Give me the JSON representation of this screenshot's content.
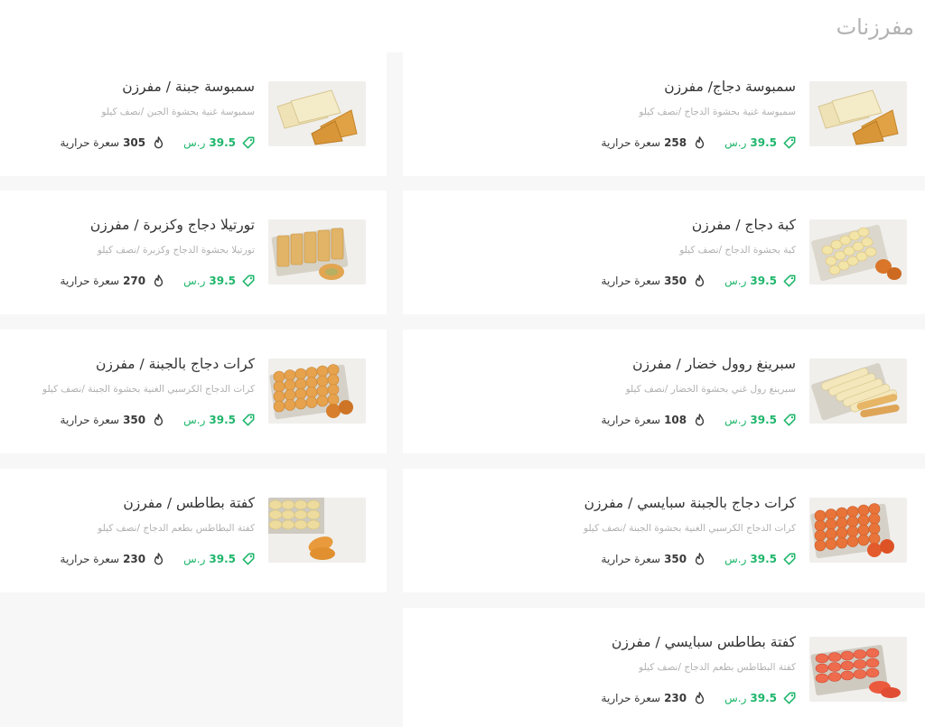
{
  "section": {
    "title": "مفرزنات"
  },
  "colors": {
    "price": "#1fb66b",
    "title": "#333333",
    "desc": "#b0b0b0",
    "background": "#f7f7f7"
  },
  "items": [
    {
      "title": "سمبوسة دجاج/ مفرزن",
      "desc": "سمبوسة غنية بحشوة الدجاج /نصف كيلو",
      "price": "39.5",
      "currency": "ر.س",
      "calories": "258",
      "calories_label": "سعرة حرارية",
      "image": "samosa-icon"
    },
    {
      "title": "سمبوسة جبنة / مفرزن",
      "desc": "سمبوسة غنية بحشوة الجبن /نصف كيلو",
      "price": "39.5",
      "currency": "ر.س",
      "calories": "305",
      "calories_label": "سعرة حرارية",
      "image": "samosa-icon"
    },
    {
      "title": "كبة دجاج / مفرزن",
      "desc": "كبة بحشوة الدجاج /نصف كيلو",
      "price": "39.5",
      "currency": "ر.س",
      "calories": "350",
      "calories_label": "سعرة حرارية",
      "image": "kibbeh-icon"
    },
    {
      "title": "تورتيلا دجاج وكزبرة / مفرزن",
      "desc": "تورتيلا بحشوة الدجاج وكزبرة /نصف كيلو",
      "price": "39.5",
      "currency": "ر.س",
      "calories": "270",
      "calories_label": "سعرة حرارية",
      "image": "tortilla-icon"
    },
    {
      "title": "سبرينغ روول خضار / مفرزن",
      "desc": "سبرينغ رول غني بحشوة الخضار /نصف كيلو",
      "price": "39.5",
      "currency": "ر.س",
      "calories": "108",
      "calories_label": "سعرة حرارية",
      "image": "spring-roll-icon"
    },
    {
      "title": "كرات دجاج بالجبنة / مفرزن",
      "desc": "كرات الدجاج الكرسبي الغنية بحشوة الجبنة /نصف كيلو",
      "price": "39.5",
      "currency": "ر.س",
      "calories": "350",
      "calories_label": "سعرة حرارية",
      "image": "chicken-balls-icon"
    },
    {
      "title": "كرات دجاج بالجبنة سبايسي / مفرزن",
      "desc": "كرات الدجاج الكرسبي الغنية بحشوة الجبنة /نصف كيلو",
      "price": "39.5",
      "currency": "ر.س",
      "calories": "350",
      "calories_label": "سعرة حرارية",
      "image": "spicy-balls-icon"
    },
    {
      "title": "كفتة بطاطس / مفرزن",
      "desc": "كفتة البطاطس بطعم الدجاج /نصف كيلو",
      "price": "39.5",
      "currency": "ر.س",
      "calories": "230",
      "calories_label": "سعرة حرارية",
      "image": "potato-kofta-icon"
    },
    {
      "title": "كفتة بطاطس سبايسي / مفرزن",
      "desc": "كفتة البطاطس بطعم الدجاج /نصف كيلو",
      "price": "39.5",
      "currency": "ر.س",
      "calories": "230",
      "calories_label": "سعرة حرارية",
      "image": "spicy-potato-kofta-icon"
    }
  ]
}
